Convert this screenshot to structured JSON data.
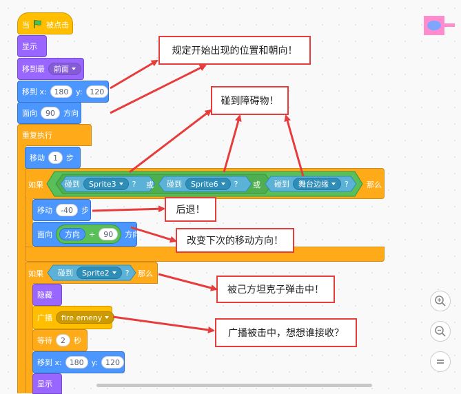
{
  "blocks": {
    "when_flag": {
      "label_pre": "当",
      "label_post": "被点击"
    },
    "show": "显示",
    "go_front": {
      "label": "移到最",
      "option": "前面"
    },
    "goto1": {
      "label": "移到 x:",
      "x": "180",
      "ylabel": "y:",
      "y": "120"
    },
    "point": {
      "label": "面向",
      "value": "90",
      "suffix": "方向"
    },
    "forever": "重复执行",
    "move": {
      "label": "移动",
      "value": "1",
      "suffix": "步"
    },
    "if1": {
      "label": "如果",
      "then": "那么",
      "or": "或",
      "touch_label": "碰到",
      "target1": "Sprite3",
      "target2": "Sprite6",
      "target3": "舞台边缘",
      "q": "?"
    },
    "move_back": {
      "label": "移动",
      "value": "-40",
      "suffix": "步"
    },
    "point2": {
      "label": "面向",
      "reporter": "方向",
      "plus": "+",
      "value": "90",
      "suffix": "方向"
    },
    "if2": {
      "label": "如果",
      "touch_label": "碰到",
      "target": "Sprite2",
      "q": "?",
      "then": "那么"
    },
    "hide": "隐藏",
    "broadcast": {
      "label": "广播",
      "message": "fire emeny"
    },
    "wait": {
      "label": "等待",
      "value": "2",
      "suffix": "秒"
    },
    "goto2": {
      "label": "移到 x:",
      "x": "180",
      "ylabel": "y:",
      "y": "120"
    },
    "show2": "显示"
  },
  "callouts": {
    "c1": "规定开始出现的位置和朝向！",
    "c2": "碰到障碍物！",
    "c3": "后退！",
    "c4": "改变下次的移动方向！",
    "c5": "被己方坦克子弹击中！",
    "c6": "广播被击中，想想谁接收？"
  },
  "colors": {
    "looks": "#9966ff",
    "motion": "#4c97ff",
    "control": "#ffab19",
    "events": "#ffbf00",
    "sensing": "#5cb1d6",
    "operators": "#59c059",
    "arrow": "#e63c3c",
    "sprite_pink": "#ff8ccf"
  },
  "icons": {
    "flag": "green-flag-icon",
    "zoom_in": "zoom-in-icon",
    "zoom_out": "zoom-out-icon",
    "zoom_reset": "zoom-reset-icon",
    "sprite": "tank-sprite-thumbnail"
  }
}
